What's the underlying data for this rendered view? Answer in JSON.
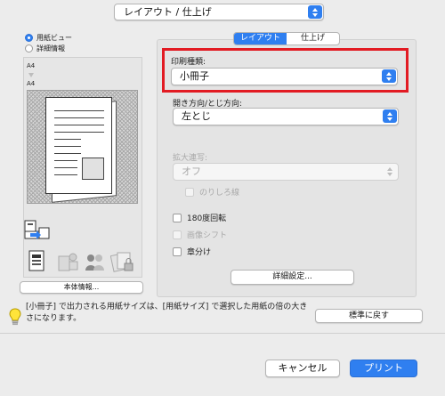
{
  "header": {
    "section_select": "レイアウト / 仕上げ"
  },
  "view_mode": {
    "options": [
      "用紙ビュー",
      "詳細情報"
    ],
    "selected": "用紙ビュー"
  },
  "preview": {
    "source_paper": "A4",
    "output_paper": "A4"
  },
  "left_buttons": {
    "device_info": "本体情報..."
  },
  "tabs": {
    "items": [
      "レイアウト",
      "仕上げ"
    ],
    "active": "レイアウト"
  },
  "print_type": {
    "label": "印刷種類:",
    "value": "小冊子"
  },
  "binding": {
    "label": "開き方向/とじ方向:",
    "value": "左とじ"
  },
  "zoom_repeat": {
    "label": "拡大連写:",
    "value": "オフ",
    "margin_line_label": "のりしろ線"
  },
  "checkboxes": {
    "rotate180": "180度回転",
    "image_shift": "画像シフト",
    "chapter_split": "章分け"
  },
  "detail_button": "詳細設定...",
  "hint": {
    "text": "[小冊子] で出力される用紙サイズは、[用紙サイズ] で選択した用紙の倍の大きさになります。"
  },
  "reset_button": "標準に戻す",
  "footer": {
    "cancel": "キャンセル",
    "print": "プリント"
  },
  "colors": {
    "accent": "#2f7ff0",
    "highlight_frame": "#e21b23"
  }
}
